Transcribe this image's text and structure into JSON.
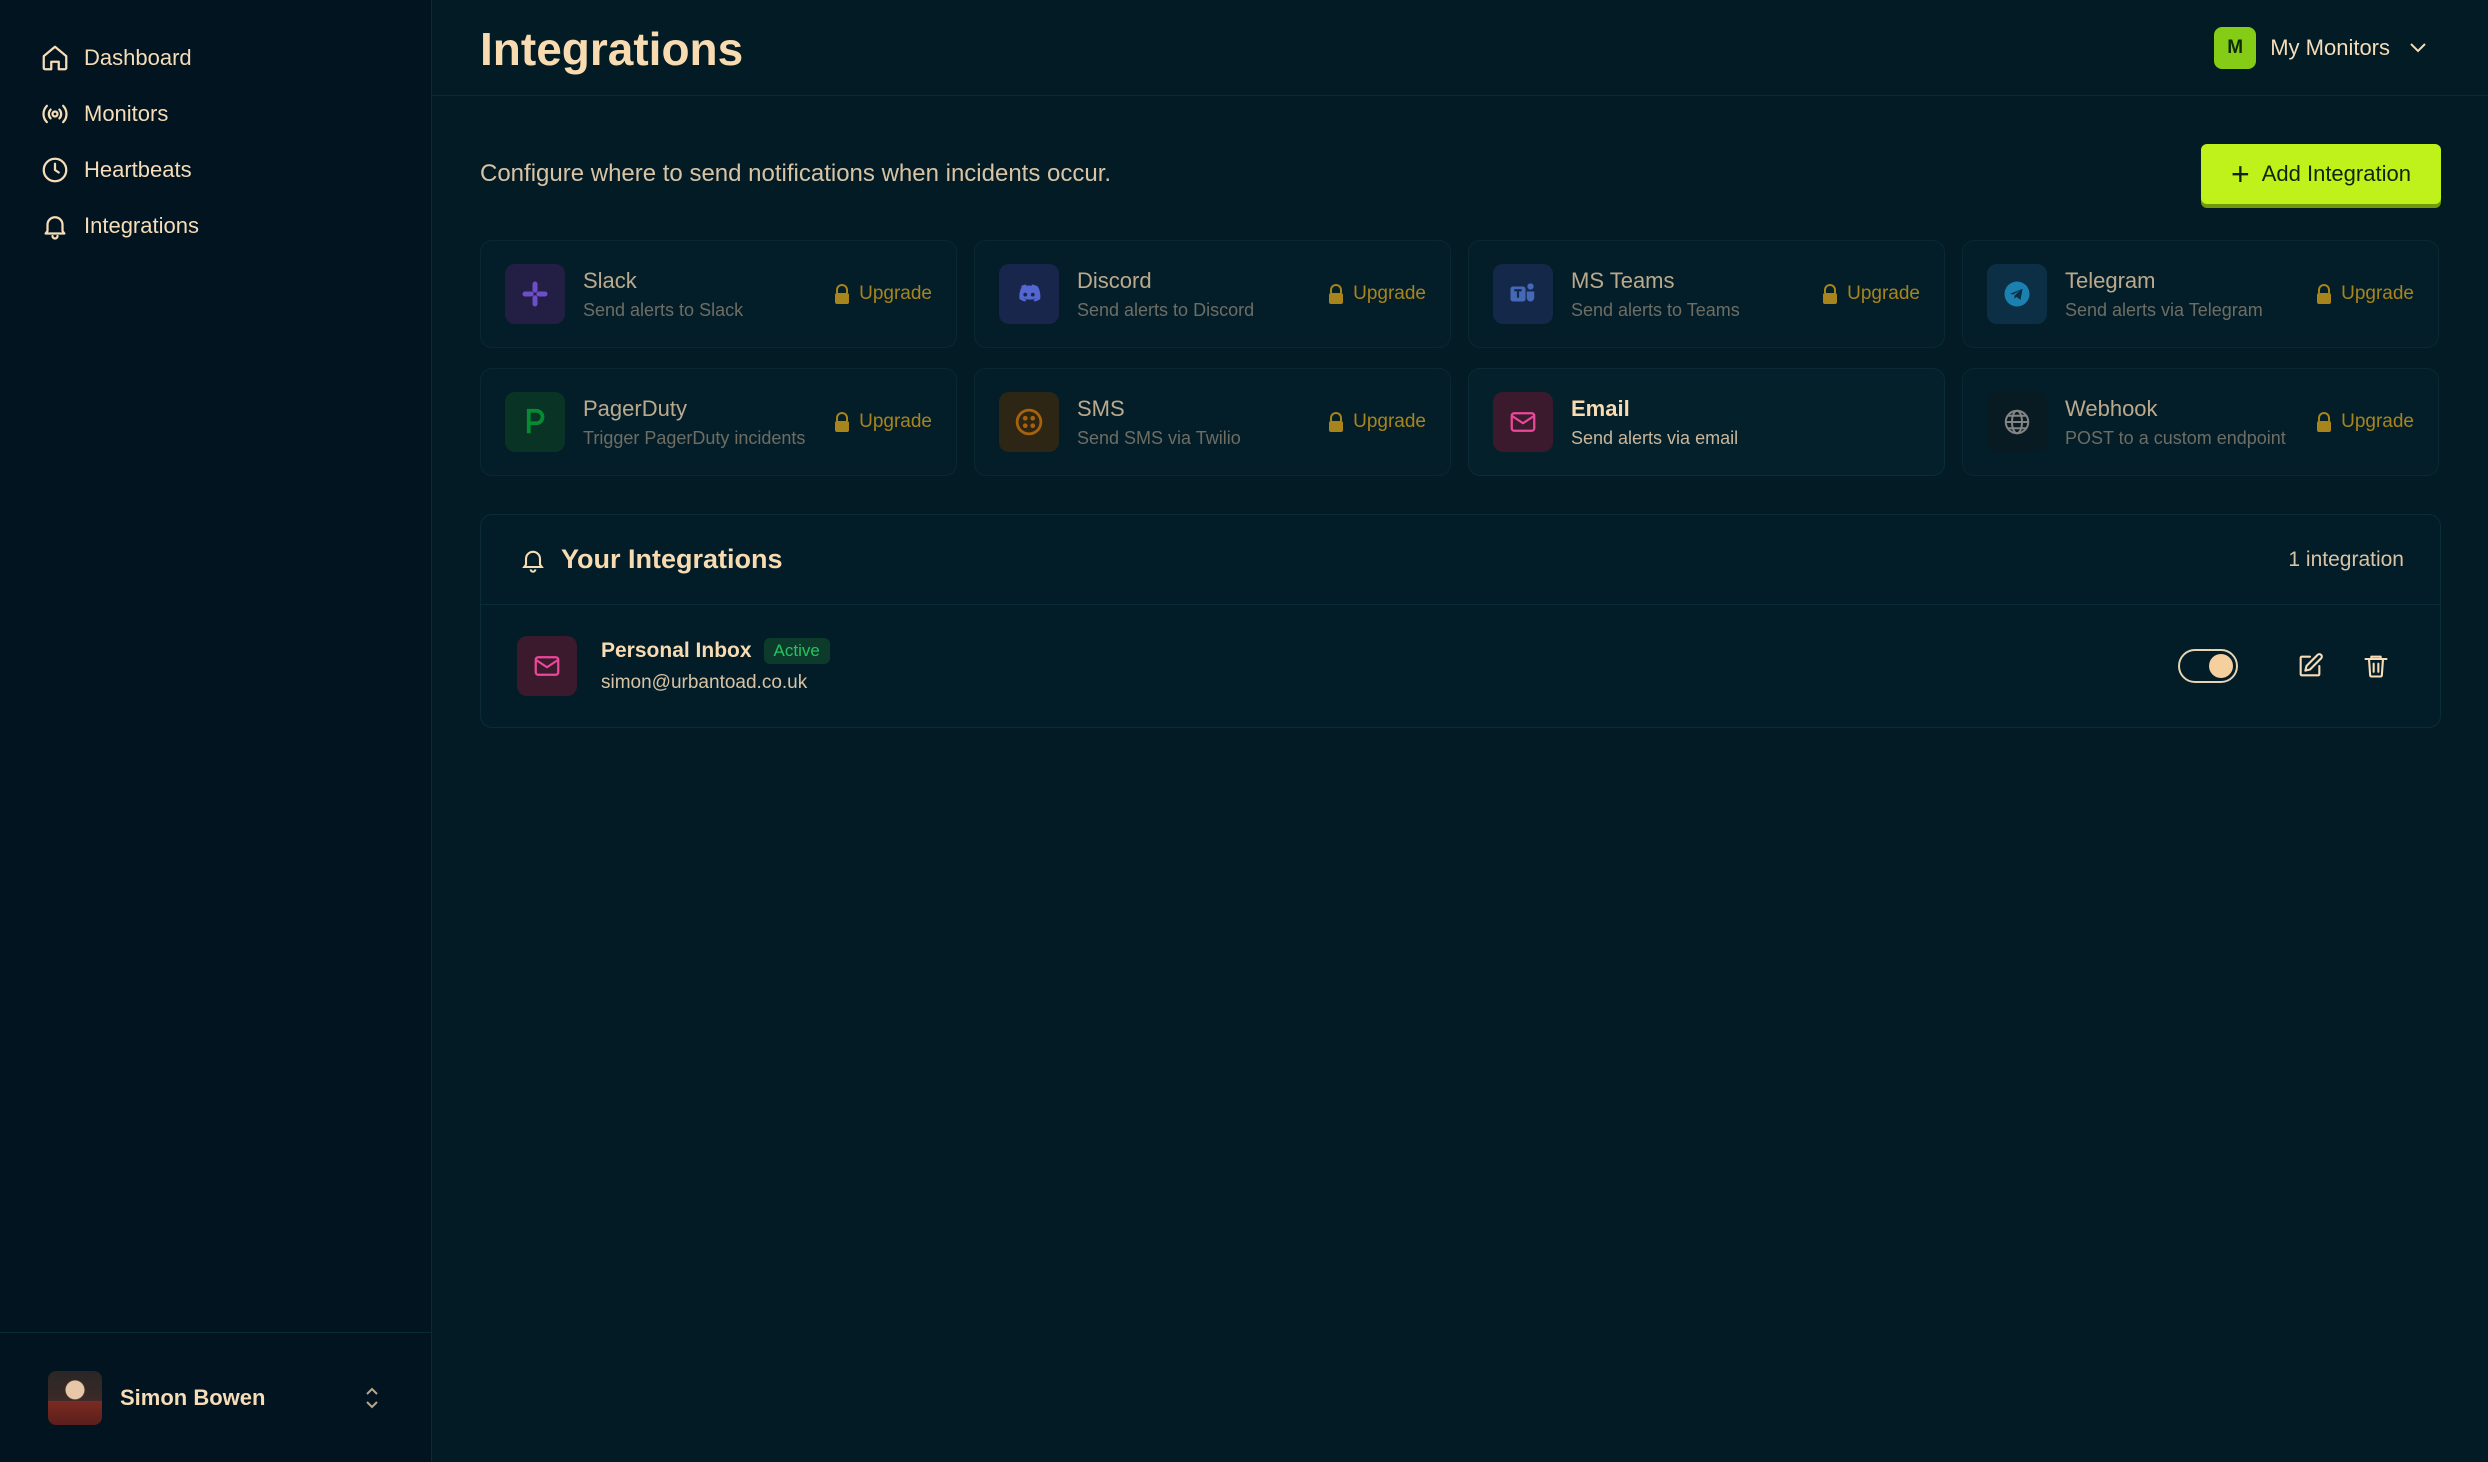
{
  "sidebar": {
    "items": [
      {
        "label": "Dashboard",
        "icon": "home-icon"
      },
      {
        "label": "Monitors",
        "icon": "broadcast-icon"
      },
      {
        "label": "Heartbeats",
        "icon": "clock-icon"
      },
      {
        "label": "Integrations",
        "icon": "bell-icon"
      }
    ],
    "user": {
      "name": "Simon Bowen"
    }
  },
  "header": {
    "title": "Integrations",
    "monitor_switch": {
      "badge": "M",
      "label": "My Monitors"
    }
  },
  "main": {
    "subtitle": "Configure where to send notifications when incidents occur.",
    "add_button": "Add Integration",
    "integration_types": [
      {
        "title": "Slack",
        "desc": "Send alerts to Slack",
        "upgrade": "Upgrade",
        "locked": true,
        "color": "#7c3aed"
      },
      {
        "title": "Discord",
        "desc": "Send alerts to Discord",
        "upgrade": "Upgrade",
        "locked": true,
        "color": "#5865f2"
      },
      {
        "title": "MS Teams",
        "desc": "Send alerts to Teams",
        "upgrade": "Upgrade",
        "locked": true,
        "color": "#4b6bd6"
      },
      {
        "title": "Telegram",
        "desc": "Send alerts via Telegram",
        "upgrade": "Upgrade",
        "locked": true,
        "color": "#229ed9"
      },
      {
        "title": "PagerDuty",
        "desc": "Trigger PagerDuty incidents",
        "upgrade": "Upgrade",
        "locked": true,
        "color": "#06ac38"
      },
      {
        "title": "SMS",
        "desc": "Send SMS via Twilio",
        "upgrade": "Upgrade",
        "locked": true,
        "color": "#d97706"
      },
      {
        "title": "Email",
        "desc": "Send alerts via email",
        "upgrade": "",
        "locked": false,
        "color": "#ec4899"
      },
      {
        "title": "Webhook",
        "desc": "POST to a custom endpoint",
        "upgrade": "Upgrade",
        "locked": true,
        "color": "#9ca3af"
      }
    ],
    "your_integrations": {
      "title": "Your Integrations",
      "count": "1 integration",
      "items": [
        {
          "name": "Personal Inbox",
          "status": "Active",
          "email": "simon@urbantoad.co.uk",
          "enabled": true
        }
      ]
    }
  },
  "colors": {
    "accent": "#bef21a",
    "upgrade": "#d6a21a",
    "active": "#22c55e"
  }
}
